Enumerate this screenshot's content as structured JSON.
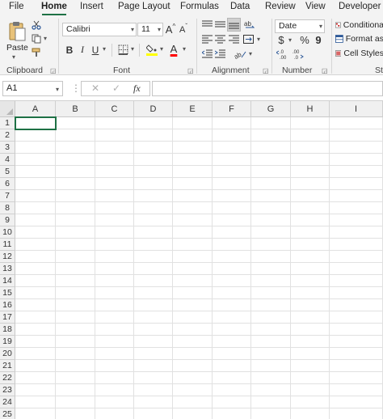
{
  "ribbon_tabs": [
    "File",
    "Home",
    "Insert",
    "Page Layout",
    "Formulas",
    "Data",
    "Review",
    "View",
    "Developer"
  ],
  "active_tab": "Home",
  "clipboard": {
    "paste_label": "Paste",
    "group_label": "Clipboard"
  },
  "font": {
    "family": "Calibri",
    "size": "11",
    "bold_label": "B",
    "italic_label": "I",
    "underline_label": "U",
    "grow_label": "A",
    "shrink_label": "A",
    "font_color_label": "A",
    "group_label": "Font"
  },
  "alignment": {
    "group_label": "Alignment"
  },
  "number": {
    "format": "Date",
    "currency_label": "$",
    "percent_label": "%",
    "comma_label": "9",
    "group_label": "Number"
  },
  "styles": {
    "conditional_label": "Conditiona",
    "format_as_label": "Format as",
    "cell_styles_label": "Cell Styles",
    "group_label": "St"
  },
  "formula_bar": {
    "name_box": "A1",
    "cancel_icon": "✕",
    "enter_icon": "✓",
    "fx_label": "fx",
    "formula_value": ""
  },
  "columns": [
    "A",
    "B",
    "C",
    "D",
    "E",
    "F",
    "G",
    "H",
    "I"
  ],
  "rows": [
    "1",
    "2",
    "3",
    "4",
    "5",
    "6",
    "7",
    "8",
    "9",
    "10",
    "11",
    "12",
    "13",
    "14",
    "15",
    "16",
    "17",
    "18",
    "19",
    "20",
    "21",
    "22",
    "23",
    "24",
    "25"
  ],
  "selected_cell": "A1",
  "colors": {
    "accent": "#1e7145",
    "highlight_yellow": "#ffff00",
    "font_red": "#ff0000",
    "ribbon_bg": "#f3f3f3"
  }
}
